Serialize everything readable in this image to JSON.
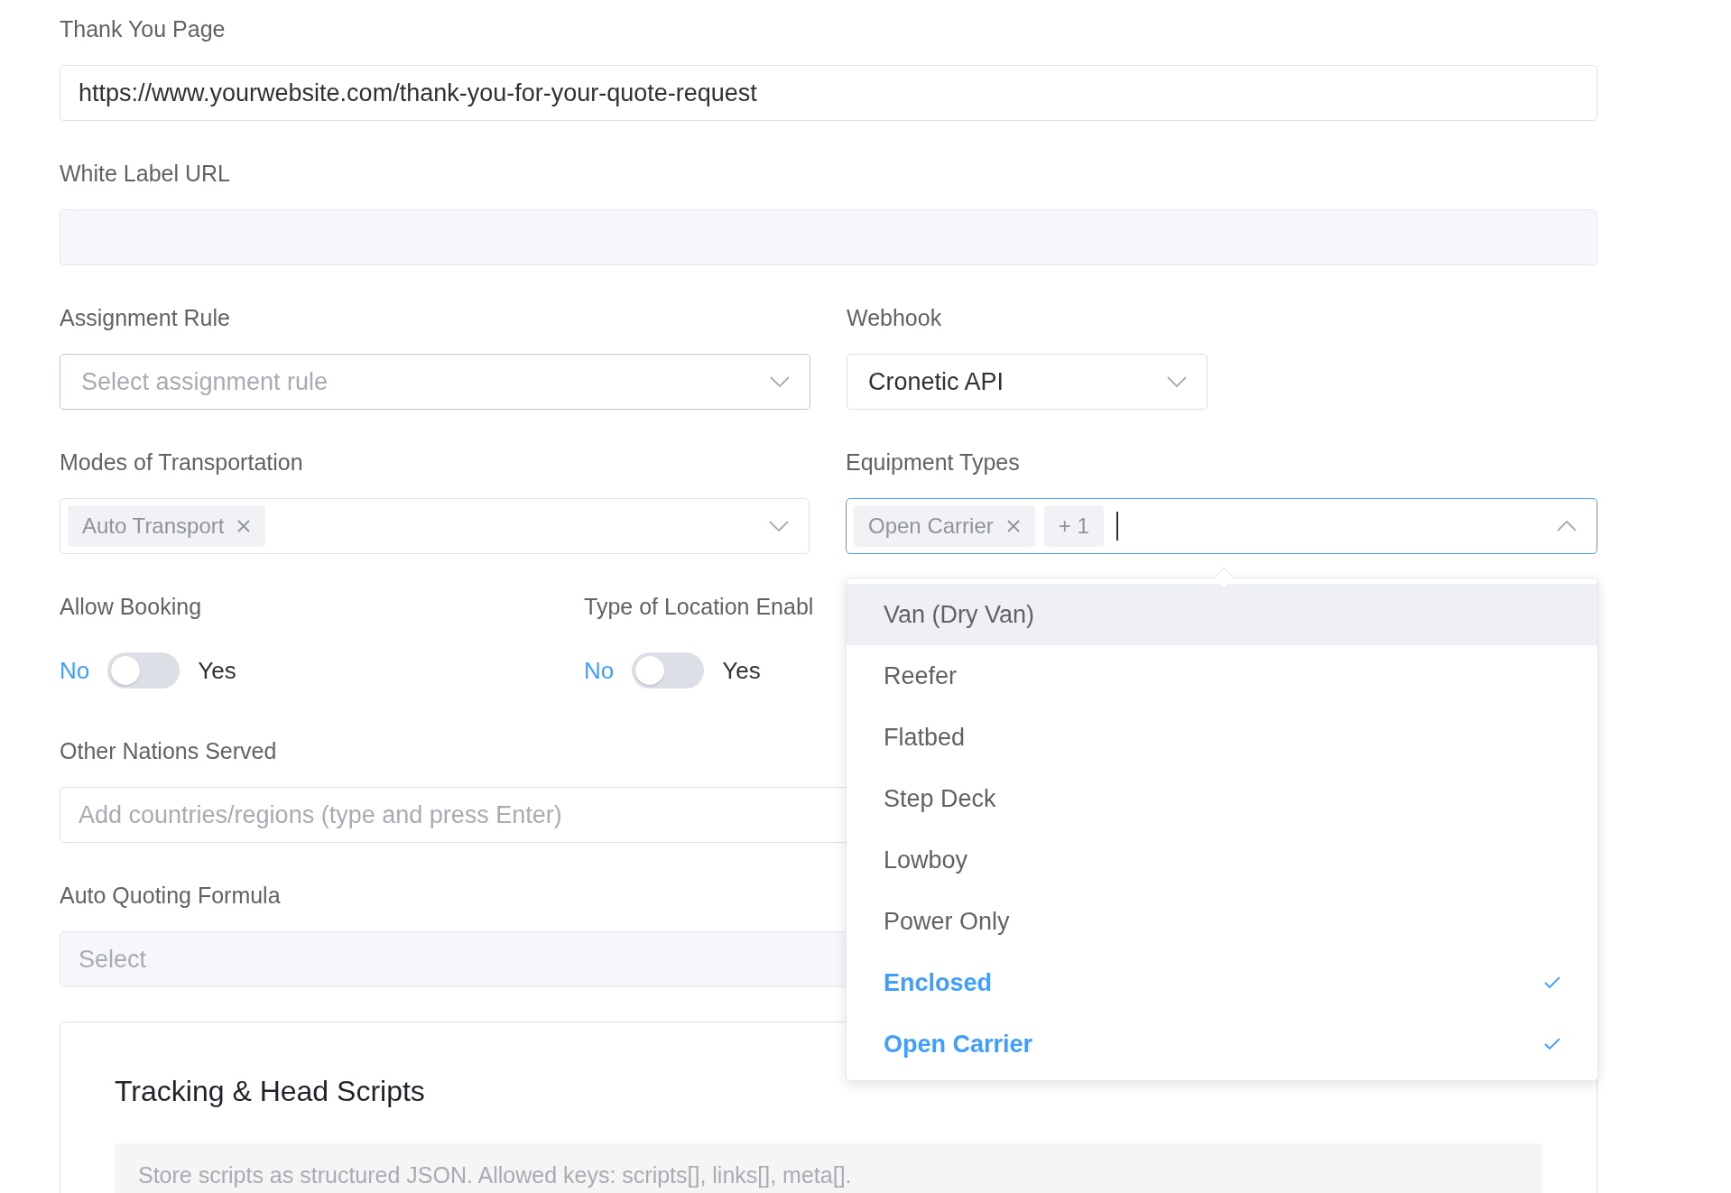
{
  "thank_you_page": {
    "label": "Thank You Page",
    "value": "https://www.yourwebsite.com/thank-you-for-your-quote-request"
  },
  "white_label_url": {
    "label": "White Label URL",
    "disabled": true
  },
  "assignment_rule": {
    "label": "Assignment Rule",
    "placeholder": "Select assignment rule"
  },
  "webhook": {
    "label": "Webhook",
    "value": "Cronetic API"
  },
  "modes_of_transportation": {
    "label": "Modes of Transportation",
    "tags": [
      "Auto Transport"
    ]
  },
  "equipment_types": {
    "label": "Equipment Types",
    "tags": [
      "Open Carrier"
    ],
    "more": "+ 1",
    "expanded": true,
    "options": [
      {
        "label": "Van (Dry Van)",
        "selected": false,
        "highlighted": true
      },
      {
        "label": "Reefer",
        "selected": false,
        "highlighted": false
      },
      {
        "label": "Flatbed",
        "selected": false,
        "highlighted": false
      },
      {
        "label": "Step Deck",
        "selected": false,
        "highlighted": false
      },
      {
        "label": "Lowboy",
        "selected": false,
        "highlighted": false
      },
      {
        "label": "Power Only",
        "selected": false,
        "highlighted": false
      },
      {
        "label": "Enclosed",
        "selected": true,
        "highlighted": false
      },
      {
        "label": "Open Carrier",
        "selected": true,
        "highlighted": false
      }
    ]
  },
  "toggles": [
    {
      "label": "Allow Booking",
      "off_label": "No",
      "on_label": "Yes",
      "on": false
    },
    {
      "label": "Type of Location Enabl",
      "off_label": "No",
      "on_label": "Yes",
      "on": false
    }
  ],
  "other_nations_served": {
    "label": "Other Nations Served",
    "placeholder": "Add countries/regions (type and press Enter)"
  },
  "auto_quoting_formula": {
    "label": "Auto Quoting Formula",
    "placeholder": "Select",
    "disabled": true
  },
  "tracking_card": {
    "title": "Tracking & Head Scripts",
    "placeholder": "Store scripts as structured JSON. Allowed keys: scripts[], links[], meta[]."
  }
}
